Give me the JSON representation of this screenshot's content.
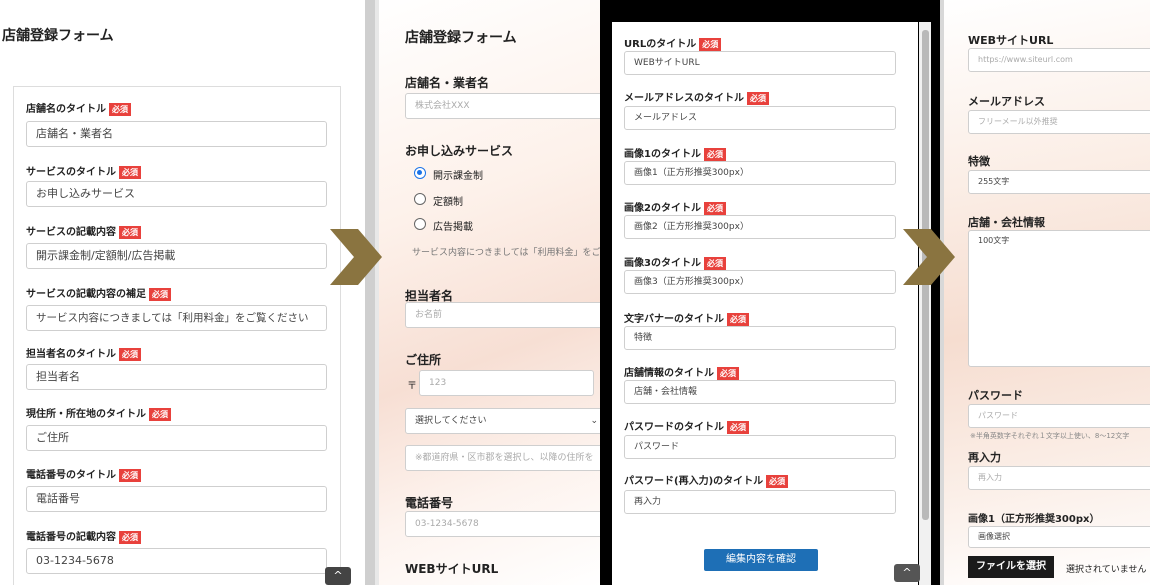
{
  "required": "必須",
  "panel1": {
    "title": "店舗登録フォーム",
    "fields": [
      {
        "label": "店舗名のタイトル",
        "value": "店舗名・業者名"
      },
      {
        "label": "サービスのタイトル",
        "value": "お申し込みサービス"
      },
      {
        "label": "サービスの記載内容",
        "value": "開示課金制/定額制/広告掲載"
      },
      {
        "label": "サービスの記載内容の補足",
        "value": "サービス内容につきましては「利用料金」をご覧ください"
      },
      {
        "label": "担当者名のタイトル",
        "value": "担当者名"
      },
      {
        "label": "現住所・所在地のタイトル",
        "value": "ご住所"
      },
      {
        "label": "電話番号のタイトル",
        "value": "電話番号"
      },
      {
        "label": "電話番号の記載内容",
        "value": "03-1234-5678"
      }
    ],
    "up_icon": "^"
  },
  "panel2": {
    "title": "店舗登録フォーム",
    "store_label": "店舗名・業者名",
    "store_placeholder": "株式会社XXX",
    "service_label": "お申し込みサービス",
    "options": [
      "開示課金制",
      "定額制",
      "広告掲載"
    ],
    "selected_option": "開示課金制",
    "service_note": "サービス内容につきましては「利用料金」をご",
    "person_label": "担当者名",
    "person_placeholder": "お名前",
    "address_label": "ご住所",
    "postal_mark": "〒",
    "postal_placeholder": "123",
    "pref_select": "選択してください",
    "address_placeholder": "※都道府県・区市郡を選択し、以降の住所を",
    "phone_label": "電話番号",
    "phone_placeholder": "03-1234-5678",
    "web_label": "WEBサイトURL"
  },
  "panel3": {
    "fields": [
      {
        "label": "URLのタイトル",
        "value": "WEBサイトURL"
      },
      {
        "label": "メールアドレスのタイトル",
        "value": "メールアドレス"
      },
      {
        "label": "画像1のタイトル",
        "value": "画像1（正方形推奨300px）"
      },
      {
        "label": "画像2のタイトル",
        "value": "画像2（正方形推奨300px）"
      },
      {
        "label": "画像3のタイトル",
        "value": "画像3（正方形推奨300px）"
      },
      {
        "label": "文字バナーのタイトル",
        "value": "特徴"
      },
      {
        "label": "店舗情報のタイトル",
        "value": "店舗・会社情報"
      },
      {
        "label": "パスワードのタイトル",
        "value": "パスワード"
      },
      {
        "label": "パスワード(再入力)のタイトル",
        "value": "再入力"
      }
    ],
    "confirm_button": "編集内容を確認",
    "up_icon": "^"
  },
  "panel4": {
    "web_label": "WEBサイトURL",
    "web_placeholder": "https://www.siteurl.com",
    "mail_label": "メールアドレス",
    "mail_placeholder": "フリーメール以外推奨",
    "feature_label": "特徴",
    "feature_value": "255文字",
    "info_label": "店舗・会社情報",
    "info_value": "100文字",
    "pw_label": "パスワード",
    "pw_placeholder": "パスワード",
    "pw_note": "※半角英数字それぞれ１文字以上使い、8〜12文字",
    "repw_label": "再入力",
    "repw_placeholder": "再入力",
    "image_label": "画像1（正方形推奨300px）",
    "image_select": "画像選択",
    "file_button": "ファイルを選択",
    "file_status": "選択されていません"
  },
  "colors": {
    "accent_red": "#e8413c",
    "button_blue": "#1e6fb6",
    "arrow": "#8a7440"
  }
}
